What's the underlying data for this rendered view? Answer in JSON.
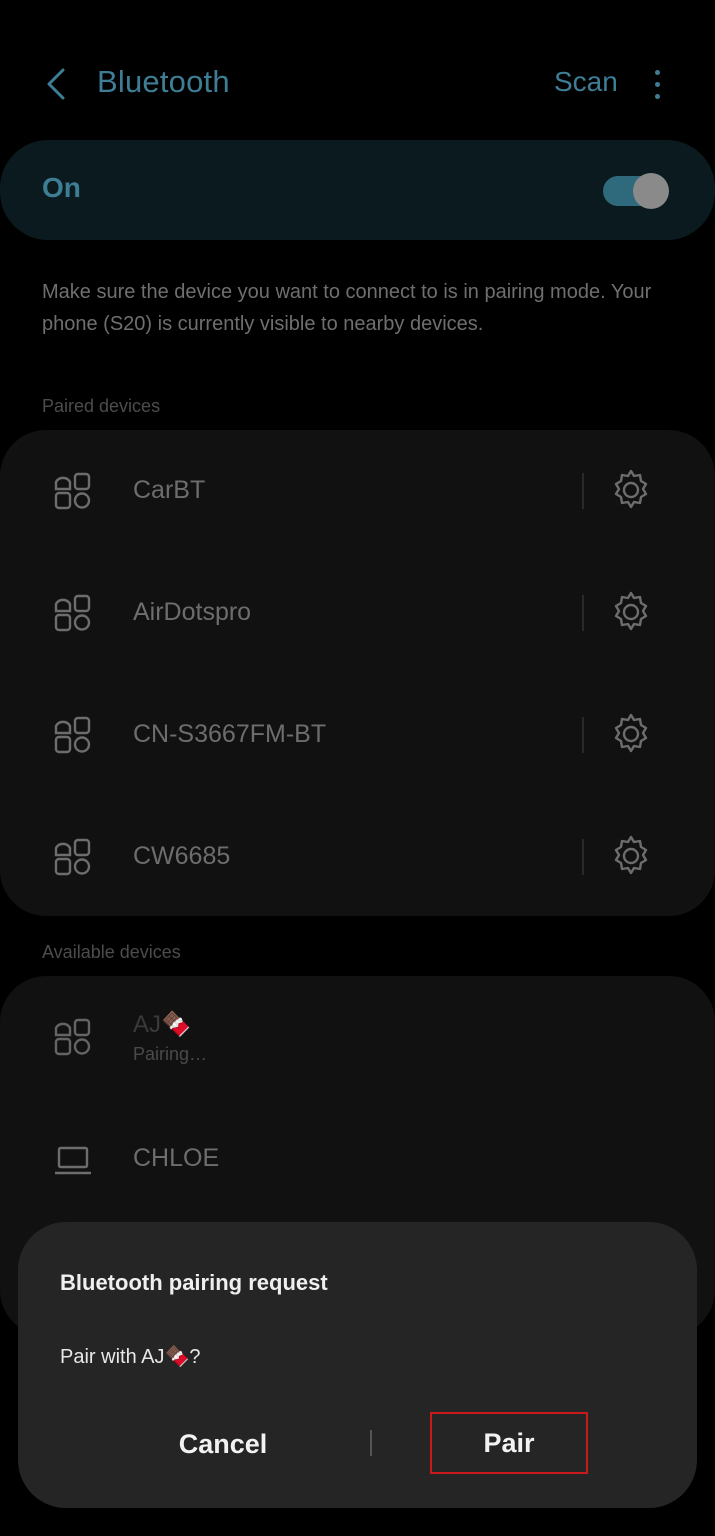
{
  "header": {
    "title": "Bluetooth",
    "scan_label": "Scan"
  },
  "toggle": {
    "label": "On",
    "state": "on"
  },
  "description": "Make sure the device you want to connect to is in pairing mode. Your phone (S20) is currently visible to nearby devices.",
  "paired": {
    "label": "Paired devices",
    "devices": [
      {
        "name": "CarBT",
        "icon": "device-grid-icon"
      },
      {
        "name": "AirDotspro",
        "icon": "device-grid-icon"
      },
      {
        "name": "CN-S3667FM-BT",
        "icon": "device-grid-icon"
      },
      {
        "name": "CW6685",
        "icon": "device-grid-icon"
      }
    ]
  },
  "available": {
    "label": "Available devices",
    "devices": [
      {
        "name": "AJ🍫",
        "status": "Pairing…",
        "icon": "device-grid-icon"
      },
      {
        "name": "CHLOE",
        "icon": "laptop-icon"
      }
    ]
  },
  "dialog": {
    "title": "Bluetooth pairing request",
    "message": "Pair with AJ🍫?",
    "cancel_label": "Cancel",
    "pair_label": "Pair"
  },
  "colors": {
    "accent": "#3e7e95",
    "highlight": "#c8191c"
  }
}
